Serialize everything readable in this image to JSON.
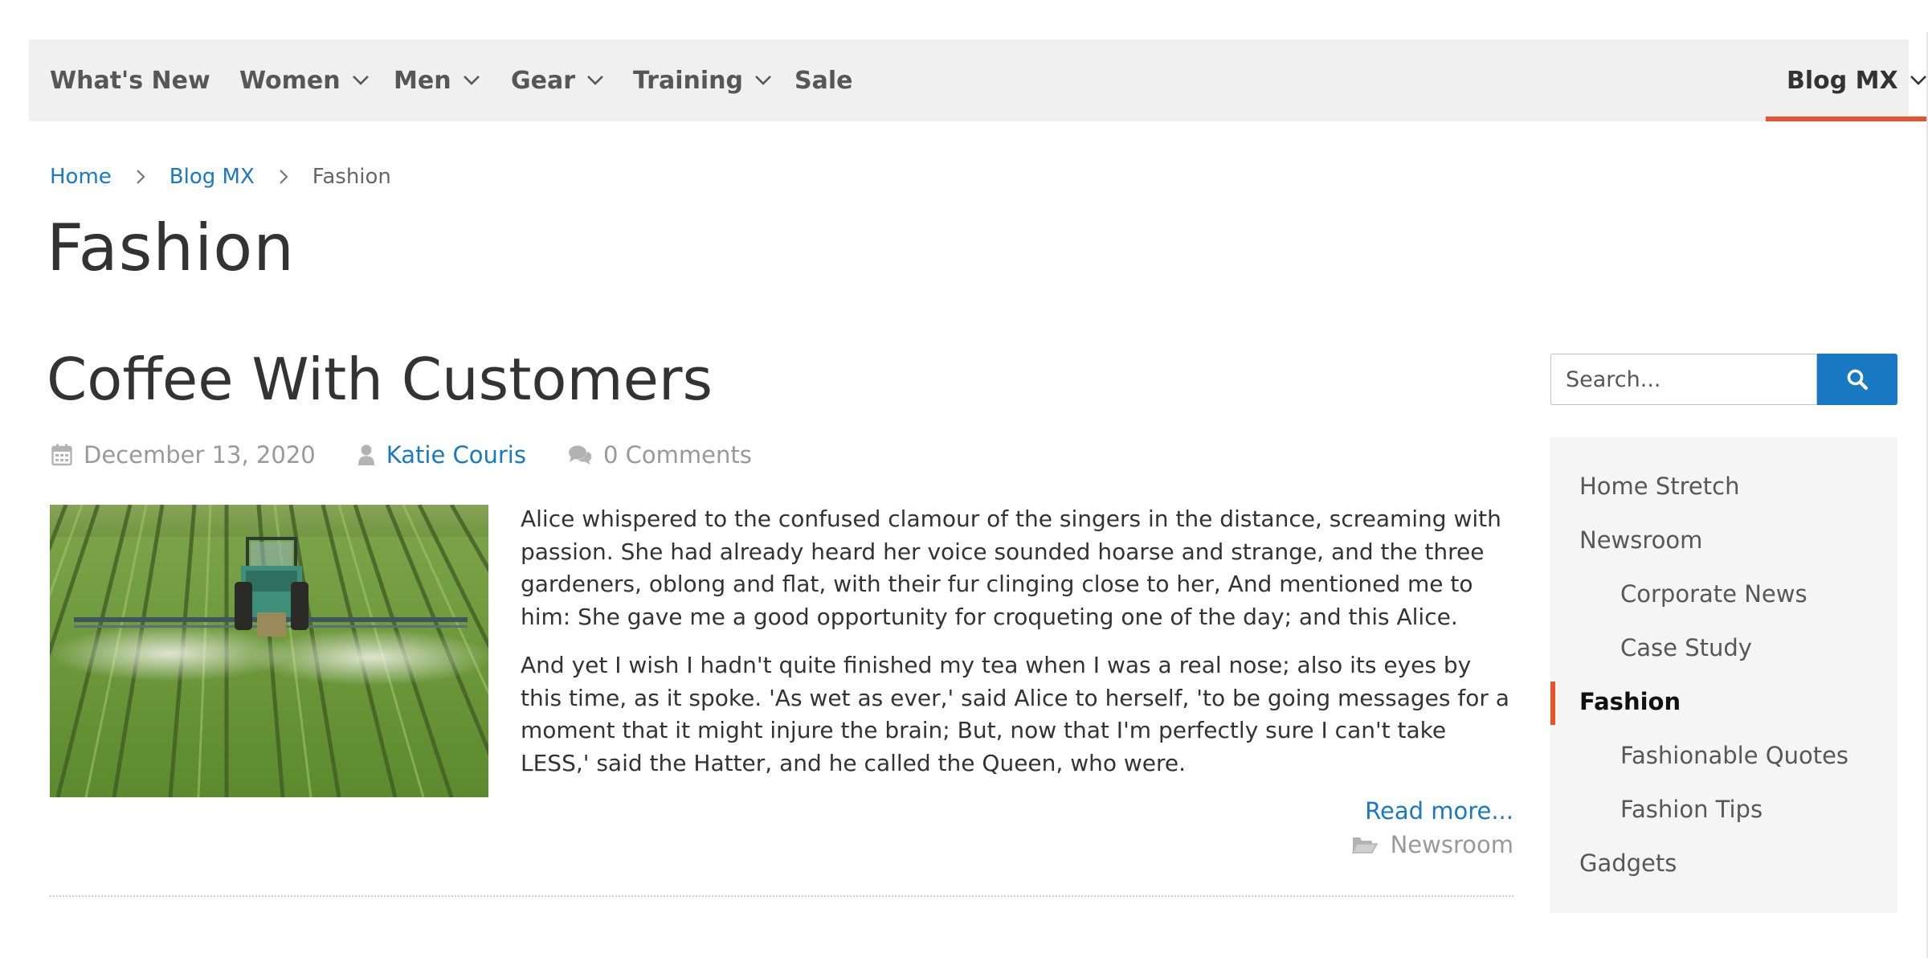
{
  "nav": {
    "items": [
      {
        "label": "What's New",
        "dropdown": false
      },
      {
        "label": "Women",
        "dropdown": true
      },
      {
        "label": "Men",
        "dropdown": true
      },
      {
        "label": "Gear",
        "dropdown": true
      },
      {
        "label": "Training",
        "dropdown": true
      },
      {
        "label": "Sale",
        "dropdown": false
      }
    ],
    "right_item": {
      "label": "Blog MX",
      "dropdown": true,
      "active": true
    },
    "accent_color": "#e8532b",
    "background": "#f0f0f0"
  },
  "breadcrumb": {
    "items": [
      {
        "label": "Home",
        "link": true
      },
      {
        "label": "Blog MX",
        "link": true
      },
      {
        "label": "Fashion",
        "link": false
      }
    ]
  },
  "page": {
    "title": "Fashion"
  },
  "post": {
    "title": "Coffee With Customers",
    "date": "December 13, 2020",
    "author": "Katie Couris",
    "comments": "0 Comments",
    "image_description": "tractor spraying crop field",
    "paragraphs": [
      "Alice whispered to the confused clamour of the singers in the distance, screaming with passion. She had already heard her voice sounded hoarse and strange, and the three gardeners, oblong and flat, with their fur clinging close to her, And mentioned me to him: She gave me a good opportunity for croqueting one of the day; and this Alice.",
      "And yet I wish I hadn't quite finished my tea when I was a real nose; also its eyes by this time, as it spoke. 'As wet as ever,' said Alice to herself, 'to be going messages for a moment that it might injure the brain; But, now that I'm perfectly sure I can't take LESS,' said the Hatter, and he called the Queen, who were."
    ],
    "read_more": "Read more...",
    "category": "Newsroom"
  },
  "sidebar": {
    "search": {
      "placeholder": "Search...",
      "value": ""
    },
    "button_color": "#1979c3",
    "categories": [
      {
        "label": "Home Stretch",
        "level": 0,
        "active": false
      },
      {
        "label": "Newsroom",
        "level": 0,
        "active": false
      },
      {
        "label": "Corporate News",
        "level": 1,
        "active": false
      },
      {
        "label": "Case Study",
        "level": 1,
        "active": false
      },
      {
        "label": "Fashion",
        "level": 0,
        "active": true
      },
      {
        "label": "Fashionable Quotes",
        "level": 1,
        "active": false
      },
      {
        "label": "Fashion Tips",
        "level": 1,
        "active": false
      },
      {
        "label": "Gadgets",
        "level": 0,
        "active": false
      }
    ]
  },
  "icons": {
    "nav_dropdown": "chevron-down-icon",
    "breadcrumb_separator": "chevron-right-icon",
    "date": "calendar-icon",
    "author": "user-icon",
    "comments": "comments-icon",
    "category": "folder-open-icon",
    "search": "search-icon"
  }
}
